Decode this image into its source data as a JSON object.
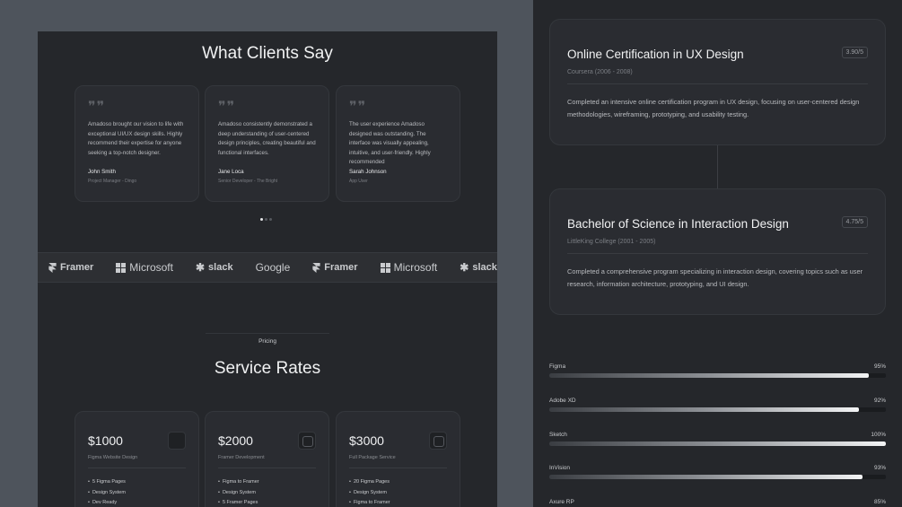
{
  "testimonials": {
    "title": "What Clients Say",
    "items": [
      {
        "text": "Amadoso brought our vision to life with exceptional UI/UX design skills. Highly recommend their expertise for anyone seeking a top-notch designer.",
        "name": "John Smith",
        "role": "Project Manager - Dingo"
      },
      {
        "text": "Amadoso consistently demonstrated a deep understanding of user-centered design principles, creating beautiful and functional interfaces.",
        "name": "Jane Loca",
        "role": "Senior Developer - The Bright"
      },
      {
        "text": "The user experience Amadoso designed was outstanding. The interface was visually appealing, intuitive, and user-friendly. Highly recommended",
        "name": "Sarah Johnson",
        "role": "App User"
      }
    ],
    "quote_glyph": "❞❞"
  },
  "logos": {
    "items": [
      {
        "name": "Framer",
        "icon": "framer-icon"
      },
      {
        "name": "Microsoft",
        "icon": "microsoft-icon"
      },
      {
        "name": "slack",
        "icon": "slack-icon"
      },
      {
        "name": "Google",
        "icon": ""
      },
      {
        "name": "Framer",
        "icon": "framer-icon"
      },
      {
        "name": "Microsoft",
        "icon": "microsoft-icon"
      },
      {
        "name": "slack",
        "icon": "slack-icon"
      }
    ]
  },
  "pricing": {
    "eyebrow": "Pricing",
    "title": "Service Rates",
    "plans": [
      {
        "price": "$1000",
        "desc": "Figma Website Design",
        "features": [
          "5 Figma Pages",
          "Design System",
          "Dev Ready"
        ]
      },
      {
        "price": "$2000",
        "desc": "Framer Development",
        "features": [
          "Figma to Framer",
          "Design System",
          "5 Framer Pages"
        ]
      },
      {
        "price": "$3000",
        "desc": "Full Package Service",
        "features": [
          "20 Figma Pages",
          "Design System",
          "Figma to Framer"
        ]
      }
    ]
  },
  "education": [
    {
      "title": "Online Certification in UX Design",
      "score": "3.90/5",
      "sub": "Coursera (2006 - 2008)",
      "desc": "Completed an intensive online certification program in UX design, focusing on user-centered design methodologies, wireframing, prototyping, and usability testing."
    },
    {
      "title": "Bachelor of Science in Interaction Design",
      "score": "4.75/5",
      "sub": "LittleKing College (2001 - 2005)",
      "desc": "Completed a comprehensive program specializing in interaction design, covering topics such as user research, information architecture, prototyping, and UI design."
    }
  ],
  "skills": [
    {
      "name": "Figma",
      "pct": "95%",
      "value": 95
    },
    {
      "name": "Adobe XD",
      "pct": "92%",
      "value": 92
    },
    {
      "name": "Sketch",
      "pct": "100%",
      "value": 100
    },
    {
      "name": "InVision",
      "pct": "93%",
      "value": 93
    },
    {
      "name": "Axure RP",
      "pct": "85%",
      "value": 85
    }
  ]
}
